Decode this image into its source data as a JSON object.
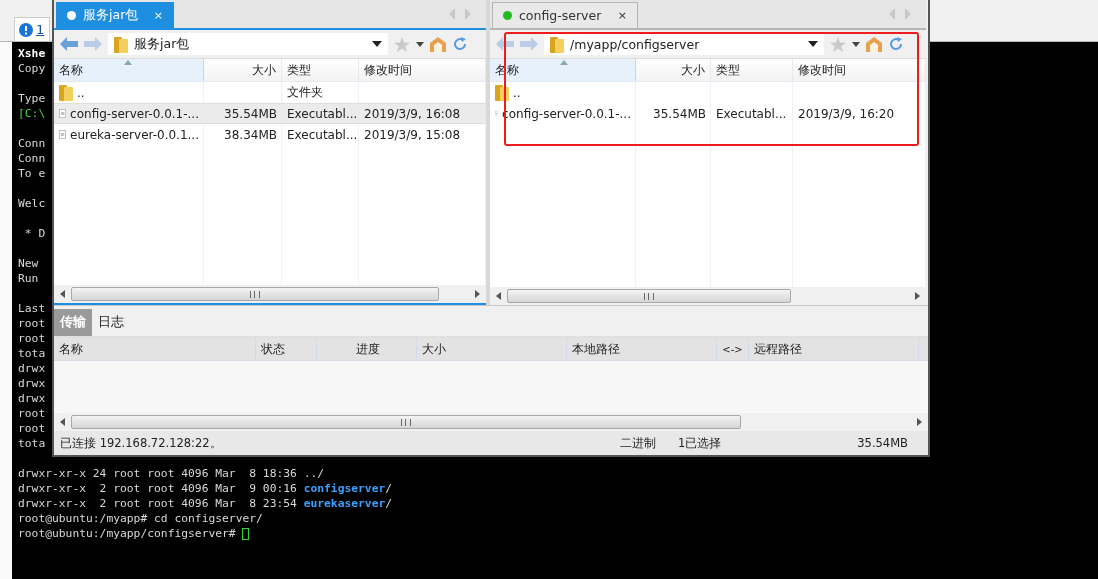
{
  "background_tab": {
    "label": "1"
  },
  "terminal": {
    "lines": [
      {
        "kind": "text",
        "parts": [
          {
            "kind": "bold",
            "text": "Xshe"
          }
        ]
      },
      {
        "kind": "text",
        "parts": [
          {
            "kind": "plain",
            "text": "Copy"
          }
        ]
      },
      {
        "kind": "blank"
      },
      {
        "kind": "text",
        "parts": [
          {
            "kind": "plain",
            "text": "Type"
          }
        ]
      },
      {
        "kind": "text",
        "parts": [
          {
            "kind": "green",
            "text": "[C:\\"
          }
        ]
      },
      {
        "kind": "blank"
      },
      {
        "kind": "text",
        "parts": [
          {
            "kind": "plain",
            "text": "Conn"
          }
        ]
      },
      {
        "kind": "text",
        "parts": [
          {
            "kind": "plain",
            "text": "Conn"
          }
        ]
      },
      {
        "kind": "text",
        "parts": [
          {
            "kind": "plain",
            "text": "To e"
          }
        ]
      },
      {
        "kind": "blank"
      },
      {
        "kind": "text",
        "parts": [
          {
            "kind": "plain",
            "text": "Welc"
          }
        ]
      },
      {
        "kind": "blank"
      },
      {
        "kind": "text",
        "parts": [
          {
            "kind": "plain",
            "text": " * D"
          }
        ]
      },
      {
        "kind": "blank"
      },
      {
        "kind": "text",
        "parts": [
          {
            "kind": "plain",
            "text": "New"
          }
        ]
      },
      {
        "kind": "text",
        "parts": [
          {
            "kind": "plain",
            "text": "Run"
          }
        ]
      },
      {
        "kind": "blank"
      },
      {
        "kind": "text",
        "parts": [
          {
            "kind": "plain",
            "text": "Last"
          }
        ]
      },
      {
        "kind": "text",
        "parts": [
          {
            "kind": "plain",
            "text": "root"
          }
        ]
      },
      {
        "kind": "text",
        "parts": [
          {
            "kind": "plain",
            "text": "root"
          }
        ]
      },
      {
        "kind": "text",
        "parts": [
          {
            "kind": "plain",
            "text": "tota"
          }
        ]
      },
      {
        "kind": "text",
        "parts": [
          {
            "kind": "plain",
            "text": "drwx"
          }
        ]
      },
      {
        "kind": "text",
        "parts": [
          {
            "kind": "plain",
            "text": "drwx"
          }
        ]
      },
      {
        "kind": "text",
        "parts": [
          {
            "kind": "plain",
            "text": "drwx"
          }
        ]
      },
      {
        "kind": "text",
        "parts": [
          {
            "kind": "plain",
            "text": "root"
          }
        ]
      },
      {
        "kind": "text",
        "parts": [
          {
            "kind": "plain",
            "text": "root"
          }
        ]
      },
      {
        "kind": "text",
        "parts": [
          {
            "kind": "plain",
            "text": "tota"
          }
        ]
      },
      {
        "kind": "blank"
      },
      {
        "kind": "text",
        "parts": [
          {
            "kind": "plain",
            "text": "drwxr-xr-x 24 root root 4096 Mar  8 18:36 ../"
          }
        ]
      },
      {
        "kind": "text",
        "parts": [
          {
            "kind": "plain",
            "text": "drwxr-xr-x  2 root root 4096 Mar  9 00:16 "
          },
          {
            "kind": "dir",
            "text": "configserver"
          },
          {
            "kind": "plain",
            "text": "/"
          }
        ]
      },
      {
        "kind": "text",
        "parts": [
          {
            "kind": "plain",
            "text": "drwxr-xr-x  2 root root 4096 Mar  8 23:54 "
          },
          {
            "kind": "dir",
            "text": "eurekaserver"
          },
          {
            "kind": "plain",
            "text": "/"
          }
        ]
      },
      {
        "kind": "text",
        "parts": [
          {
            "kind": "plain",
            "text": "root@ubuntu:/myapp# cd configserver/"
          }
        ]
      },
      {
        "kind": "text",
        "cursor": true,
        "parts": [
          {
            "kind": "plain",
            "text": "root@ubuntu:/myapp/configserver# "
          }
        ]
      }
    ]
  },
  "sftp_window": {
    "panes": [
      {
        "selected": true,
        "tab": {
          "label": "服务jar包",
          "color": "#ffffff",
          "close": "×"
        },
        "path": "服务jar包",
        "columns": [
          "名称",
          "大小",
          "类型",
          "修改时间"
        ],
        "rows": [
          {
            "kind": "folder",
            "selected": false,
            "name": "..",
            "type": "文件夹"
          },
          {
            "kind": "file",
            "selected": true,
            "name": "config-server-0.0.1-...",
            "size": "35.54MB",
            "type": "Executabl...",
            "modified": "2019/3/9, 16:08"
          },
          {
            "kind": "file",
            "selected": false,
            "name": "eureka-server-0.0.1...",
            "size": "38.34MB",
            "type": "Executabl...",
            "modified": "2019/3/9, 15:08"
          }
        ]
      },
      {
        "selected": false,
        "highlighted": true,
        "tab": {
          "label": "config-server",
          "color": "#22bb22",
          "close": "×"
        },
        "path": "/myapp/configserver",
        "columns": [
          "名称",
          "大小",
          "类型",
          "修改时间"
        ],
        "rows": [
          {
            "kind": "folder",
            "selected": false,
            "name": ".."
          },
          {
            "kind": "file",
            "selected": false,
            "name": "config-server-0.0.1-...",
            "size": "35.54MB",
            "type": "Executabl...",
            "modified": "2019/3/9, 16:20"
          }
        ]
      }
    ],
    "bottom_tabs": [
      {
        "label": "传输",
        "selected": true
      },
      {
        "label": "日志",
        "selected": false
      }
    ],
    "transfer_columns": [
      "名称",
      "状态",
      "进度",
      "大小",
      "本地路径",
      "<->",
      "远程路径"
    ],
    "status_bar": {
      "connection": "已连接 192.168.72.128:22。",
      "mode": "二进制",
      "selection": "1已选择",
      "size": "35.54MB"
    }
  }
}
